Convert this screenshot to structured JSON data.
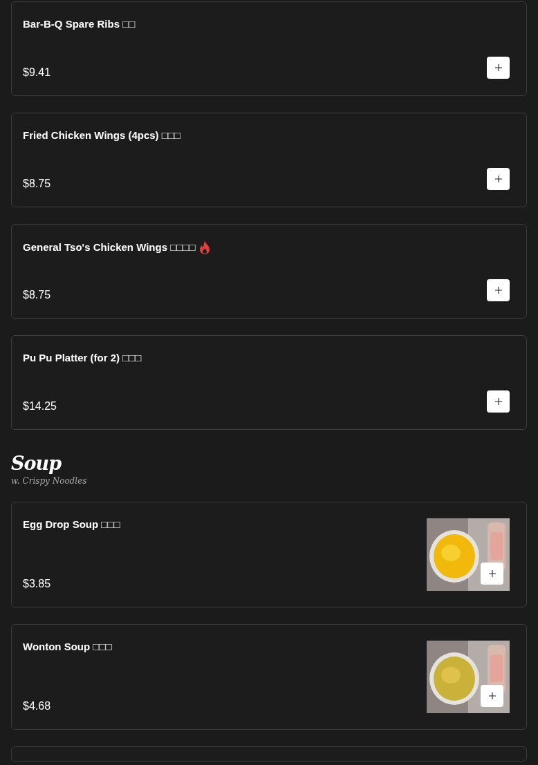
{
  "sections": [
    {
      "items": [
        {
          "name": "Bar-B-Q Spare Ribs □□",
          "price": "$9.41",
          "spicy": false
        },
        {
          "name": "Fried Chicken Wings (4pcs) □□□",
          "price": "$8.75",
          "spicy": false
        },
        {
          "name": "General Tso's Chicken Wings □□□□",
          "price": "$8.75",
          "spicy": true
        },
        {
          "name": "Pu Pu Platter (for 2) □□□",
          "price": "$14.25",
          "spicy": false
        }
      ]
    },
    {
      "title": "Soup",
      "subtitle": "w. Crispy Noodles",
      "items": [
        {
          "name": "Egg Drop Soup □□□",
          "price": "$3.85",
          "spicy": false
        },
        {
          "name": "Wonton Soup □□□",
          "price": "$4.68",
          "spicy": false
        }
      ],
      "more_below": true
    }
  ]
}
